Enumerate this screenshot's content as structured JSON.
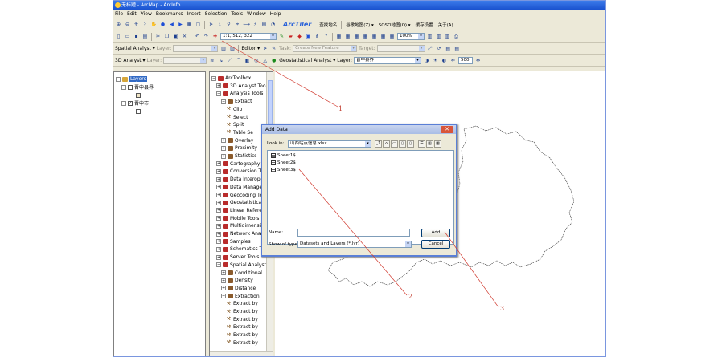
{
  "window": {
    "title": "无标题 - ArcMap - ArcInfo"
  },
  "menu": [
    "File",
    "Edit",
    "View",
    "Bookmarks",
    "Insert",
    "Selection",
    "Tools",
    "Window",
    "Help"
  ],
  "toolbar1": {
    "arctiler": "ArcTiler",
    "buttons": [
      "查找地名",
      "谷歌地图(Z) ▾",
      "SOSO地图(Q) ▾",
      "缓存设置",
      "关于(A)"
    ]
  },
  "toolbar2": {
    "scale": "1:1, 512, 322",
    "zoom": "100%"
  },
  "toolbar3": {
    "spatial_analyst": "Spatial Analyst ▾",
    "layer_label": "Layer:",
    "editor": "Editor ▾",
    "task_label": "Task:",
    "task_value": "Create New Feature",
    "target_label": "Target:"
  },
  "toolbar4": {
    "analyst_3d": "3D Analyst ▾",
    "layer_label": "Layer:",
    "geostat": "Geostatistical Analyst ▾",
    "layer2_label": "Layer:",
    "layer2_value": "晋中县界",
    "value": "500"
  },
  "toc": {
    "root": "Layers",
    "layer1": "晋中县界",
    "layer2": "晋中市"
  },
  "toolbox": {
    "items": [
      {
        "label": "ArcToolbox",
        "indent": 0,
        "kind": "root"
      },
      {
        "label": "3D Analyst Tools",
        "indent": 1,
        "kind": "box"
      },
      {
        "label": "Analysis Tools",
        "indent": 1,
        "kind": "box"
      },
      {
        "label": "Extract",
        "indent": 2,
        "kind": "set"
      },
      {
        "label": "Clip",
        "indent": 3,
        "kind": "tool"
      },
      {
        "label": "Select",
        "indent": 3,
        "kind": "tool"
      },
      {
        "label": "Split",
        "indent": 3,
        "kind": "tool"
      },
      {
        "label": "Table Se",
        "indent": 3,
        "kind": "tool"
      },
      {
        "label": "Overlay",
        "indent": 2,
        "kind": "set"
      },
      {
        "label": "Proximity",
        "indent": 2,
        "kind": "set"
      },
      {
        "label": "Statistics",
        "indent": 2,
        "kind": "set"
      },
      {
        "label": "Cartography T",
        "indent": 1,
        "kind": "box"
      },
      {
        "label": "Conversion Too",
        "indent": 1,
        "kind": "box"
      },
      {
        "label": "Data Interopera",
        "indent": 1,
        "kind": "box"
      },
      {
        "label": "Data Managem",
        "indent": 1,
        "kind": "box"
      },
      {
        "label": "Geocoding Tool",
        "indent": 1,
        "kind": "box"
      },
      {
        "label": "Geostatistical A",
        "indent": 1,
        "kind": "box"
      },
      {
        "label": "Linear Referen",
        "indent": 1,
        "kind": "box"
      },
      {
        "label": "Mobile Tools",
        "indent": 1,
        "kind": "box"
      },
      {
        "label": "Multidimension",
        "indent": 1,
        "kind": "box"
      },
      {
        "label": "Network Analy",
        "indent": 1,
        "kind": "box"
      },
      {
        "label": "Samples",
        "indent": 1,
        "kind": "box"
      },
      {
        "label": "Schematics Too",
        "indent": 1,
        "kind": "box"
      },
      {
        "label": "Server Tools",
        "indent": 1,
        "kind": "box"
      },
      {
        "label": "Spatial Analyst T",
        "indent": 1,
        "kind": "box"
      },
      {
        "label": "Conditional",
        "indent": 2,
        "kind": "set"
      },
      {
        "label": "Density",
        "indent": 2,
        "kind": "set"
      },
      {
        "label": "Distance",
        "indent": 2,
        "kind": "set"
      },
      {
        "label": "Extraction",
        "indent": 2,
        "kind": "set"
      },
      {
        "label": "Extract by",
        "indent": 3,
        "kind": "tool"
      },
      {
        "label": "Extract by",
        "indent": 3,
        "kind": "tool"
      },
      {
        "label": "Extract by",
        "indent": 3,
        "kind": "tool"
      },
      {
        "label": "Extract by",
        "indent": 3,
        "kind": "tool"
      },
      {
        "label": "Extract by",
        "indent": 3,
        "kind": "tool"
      },
      {
        "label": "Extract by",
        "indent": 3,
        "kind": "tool"
      }
    ]
  },
  "dialog": {
    "title": "Add Data",
    "look_in_label": "Look in:",
    "look_in_value": "山西站点信息.xlsx",
    "files": [
      "Sheet1$",
      "Sheet2$",
      "Sheet3$"
    ],
    "name_label": "Name:",
    "name_value": "",
    "type_label": "Show of type:",
    "type_value": "Datasets and Layers (*.lyr)",
    "add_button": "Add",
    "cancel_button": "Cancel"
  },
  "annotations": [
    "1",
    "2",
    "3"
  ]
}
